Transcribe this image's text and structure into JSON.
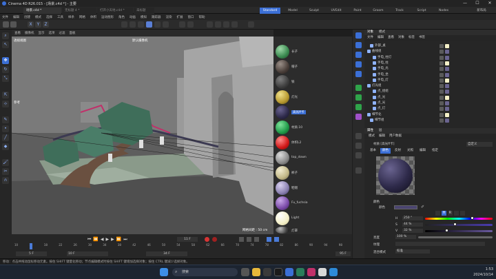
{
  "window": {
    "title": "Cinema 4D R26.015 - [场景.c4d *] - 主要"
  },
  "doc_tabs": [
    "场景.c4d *",
    "无标题 4 *",
    "打开小天地.c4d *",
    "未标题"
  ],
  "layouts": [
    "Standard",
    "Model",
    "Sculpt",
    "UVEdit",
    "Paint",
    "Groom",
    "Track",
    "Script",
    "Nodes"
  ],
  "right_top_label": "新布局",
  "menu": [
    "文件",
    "编辑",
    "创建",
    "模式",
    "选择",
    "工具",
    "样条",
    "网格",
    "体积",
    "运动图形",
    "角色",
    "动画",
    "模拟",
    "跟踪器",
    "渲染",
    "扩展",
    "窗口",
    "帮助"
  ],
  "viewport": {
    "menu": [
      "查看",
      "摄像机",
      "显示",
      "选项",
      "过滤",
      "面板"
    ],
    "view_name": "透视视图",
    "camera_label": "默认摄像机",
    "side_label": "参考",
    "grid_spacing": "网格间距 : 50 cm"
  },
  "materials": {
    "items": [
      "长子",
      "帽子",
      "铁",
      "灯光",
      "高光ff卡",
      "材质.10",
      "体积L2",
      "top_down",
      "裤子",
      "鞋帽",
      "Fu_fuchsia",
      "Light",
      "灯罩"
    ],
    "selected": "高光ff卡"
  },
  "timeline": {
    "ticks": [
      "10",
      "12",
      "14",
      "16",
      "18",
      "20",
      "22",
      "24",
      "26",
      "28",
      "30",
      "32",
      "34",
      "36",
      "38",
      "40",
      "42",
      "44",
      "46",
      "48",
      "50",
      "52",
      "54",
      "56",
      "58",
      "60",
      "62",
      "64",
      "66",
      "68",
      "70",
      "72",
      "74",
      "76",
      "78",
      "80",
      "82",
      "84",
      "86",
      "88",
      "90",
      "92",
      "94",
      "96",
      "98"
    ],
    "current_frame": "11 F",
    "start": "10 F",
    "fields": [
      "5 F",
      "10 F",
      "34 F",
      "95 F"
    ]
  },
  "objects_panel": {
    "tabs": [
      "对象",
      "模式"
    ],
    "menu": [
      "文件",
      "编辑",
      "查看",
      "对象",
      "标签",
      "书签"
    ],
    "rows": [
      "外部_桌",
      "曲线组",
      "手电_柱灯",
      "手电_柱",
      "手电_光",
      "手电_坐",
      "手电_灯",
      "灯光组",
      "点_组组",
      "点_光",
      "点_光",
      "点_灯",
      "细节化",
      "细节组"
    ]
  },
  "attributes_panel": {
    "tabs": [
      "属性",
      "层"
    ],
    "menu": [
      "模式",
      "编辑",
      "用户数据"
    ],
    "mode": "自定义",
    "material_name": "材质 [高光ff卡]",
    "sub_tabs": [
      "基本",
      "颜色",
      "反射",
      "光照",
      "编辑",
      "指定"
    ],
    "section": "颜色",
    "color_label": "颜色",
    "h_label": "H",
    "h_value": "250 °",
    "s_label": "S",
    "s_value": "44 %",
    "v_label": "V",
    "v_value": "32 %",
    "brightness_label": "亮度",
    "brightness_value": "100 %",
    "texture_label": "纹理",
    "mix_label": "混合模式",
    "mix_value": "标准",
    "colors": {
      "swatch": "#4a4470",
      "h_fraction": 0.69,
      "s_fraction": 0.44,
      "v_fraction": 0.32
    }
  },
  "status": {
    "text": "移动：点击并拖动鼠标移动元素。按住 SHIFT 键量化移动；节点编辑模式时按住 SHIFT 键增加选择对象；按住 CTRL 键减少选择对象。"
  },
  "taskbar": {
    "search": "搜索",
    "time": "1:53",
    "date": "2024/10/14"
  }
}
